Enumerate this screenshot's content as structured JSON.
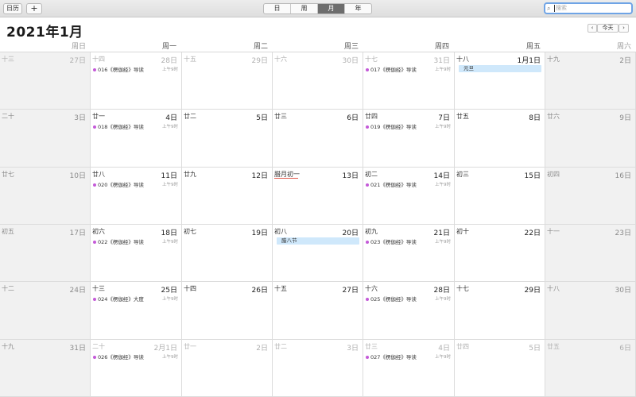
{
  "toolbar": {
    "calendars_label": "日历",
    "add_label": "+",
    "views": [
      "日",
      "周",
      "月",
      "年"
    ],
    "active_view": "月",
    "search_placeholder": "搜索",
    "search_icon": "⌕"
  },
  "header": {
    "title": "2021年1月",
    "prev": "‹",
    "today": "今天",
    "next": "›"
  },
  "weekdays": [
    "周日",
    "周一",
    "周二",
    "周三",
    "周四",
    "周五",
    "周六"
  ],
  "weeks": [
    [
      {
        "lunar": "十三",
        "day": "27日",
        "other": true
      },
      {
        "lunar": "十四",
        "day": "28日",
        "other": true,
        "event": {
          "title": "016《楞伽经》导读",
          "time": "上午9时"
        }
      },
      {
        "lunar": "十五",
        "day": "29日",
        "other": true
      },
      {
        "lunar": "十六",
        "day": "30日",
        "other": true
      },
      {
        "lunar": "十七",
        "day": "31日",
        "other": true,
        "event": {
          "title": "017《楞伽经》导读",
          "time": "上午9时"
        }
      },
      {
        "lunar": "十八",
        "day": "1月1日",
        "allday": "元旦"
      },
      {
        "lunar": "十九",
        "day": "2日"
      }
    ],
    [
      {
        "lunar": "二十",
        "day": "3日"
      },
      {
        "lunar": "廿一",
        "day": "4日",
        "event": {
          "title": "018《楞伽经》导读",
          "time": "上午9时"
        }
      },
      {
        "lunar": "廿二",
        "day": "5日"
      },
      {
        "lunar": "廿三",
        "day": "6日"
      },
      {
        "lunar": "廿四",
        "day": "7日",
        "event": {
          "title": "019《楞伽经》导读",
          "time": "上午9时"
        }
      },
      {
        "lunar": "廿五",
        "day": "8日"
      },
      {
        "lunar": "廿六",
        "day": "9日"
      }
    ],
    [
      {
        "lunar": "廿七",
        "day": "10日"
      },
      {
        "lunar": "廿八",
        "day": "11日",
        "event": {
          "title": "020《楞伽经》导读",
          "time": "上午9时"
        }
      },
      {
        "lunar": "廿九",
        "day": "12日"
      },
      {
        "lunar": "腊月初一",
        "day": "13日",
        "festival": true
      },
      {
        "lunar": "初二",
        "day": "14日",
        "event": {
          "title": "021《楞伽经》导读",
          "time": "上午9时"
        }
      },
      {
        "lunar": "初三",
        "day": "15日"
      },
      {
        "lunar": "初四",
        "day": "16日"
      }
    ],
    [
      {
        "lunar": "初五",
        "day": "17日"
      },
      {
        "lunar": "初六",
        "day": "18日",
        "event": {
          "title": "022《楞伽经》导读",
          "time": "上午9时"
        }
      },
      {
        "lunar": "初七",
        "day": "19日"
      },
      {
        "lunar": "初八",
        "day": "20日",
        "allday": "腊八节"
      },
      {
        "lunar": "初九",
        "day": "21日",
        "event": {
          "title": "023《楞伽经》导读",
          "time": "上午9时"
        }
      },
      {
        "lunar": "初十",
        "day": "22日"
      },
      {
        "lunar": "十一",
        "day": "23日"
      }
    ],
    [
      {
        "lunar": "十二",
        "day": "24日"
      },
      {
        "lunar": "十三",
        "day": "25日",
        "event": {
          "title": "024《楞伽经》大度",
          "time": "上午9时"
        }
      },
      {
        "lunar": "十四",
        "day": "26日"
      },
      {
        "lunar": "十五",
        "day": "27日"
      },
      {
        "lunar": "十六",
        "day": "28日",
        "event": {
          "title": "025《楞伽经》导读",
          "time": "上午9时"
        }
      },
      {
        "lunar": "十七",
        "day": "29日"
      },
      {
        "lunar": "十八",
        "day": "30日"
      }
    ],
    [
      {
        "lunar": "十九",
        "day": "31日"
      },
      {
        "lunar": "二十",
        "day": "2月1日",
        "other": true,
        "event": {
          "title": "026《楞伽经》导读",
          "time": "上午9时"
        }
      },
      {
        "lunar": "廿一",
        "day": "2日",
        "other": true
      },
      {
        "lunar": "廿二",
        "day": "3日",
        "other": true
      },
      {
        "lunar": "廿三",
        "day": "4日",
        "other": true,
        "event": {
          "title": "027《楞伽经》导读",
          "time": "上午9时"
        }
      },
      {
        "lunar": "廿四",
        "day": "5日",
        "other": true
      },
      {
        "lunar": "廿五",
        "day": "6日",
        "other": true
      }
    ]
  ]
}
